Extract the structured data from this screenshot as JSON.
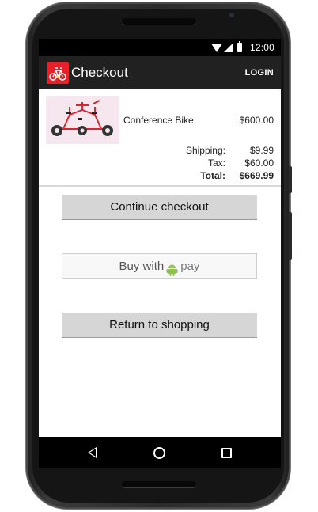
{
  "status_bar": {
    "time": "12:00",
    "icons": [
      "wifi-icon",
      "signal-icon",
      "battery-icon"
    ]
  },
  "app_bar": {
    "title": "Checkout",
    "login_label": "LOGIN",
    "logo_icon": "bike-logo-icon",
    "accent": "#e8202a",
    "bar_color": "#212121"
  },
  "product": {
    "name": "Conference Bike",
    "price": "$600.00",
    "image_icon": "conference-bike-image"
  },
  "summary": [
    {
      "label": "Shipping:",
      "value": "$9.99"
    },
    {
      "label": "Tax:",
      "value": "$60.00"
    },
    {
      "label": "Total:",
      "value": "$669.99"
    }
  ],
  "buttons": {
    "continue": "Continue checkout",
    "android_pay_prefix": "Buy with",
    "android_pay_word": "pay",
    "android_icon_color": "#8bc34a",
    "return": "Return to shopping"
  },
  "nav_bar": {
    "icons": [
      "back-icon",
      "home-icon",
      "recents-icon"
    ]
  }
}
